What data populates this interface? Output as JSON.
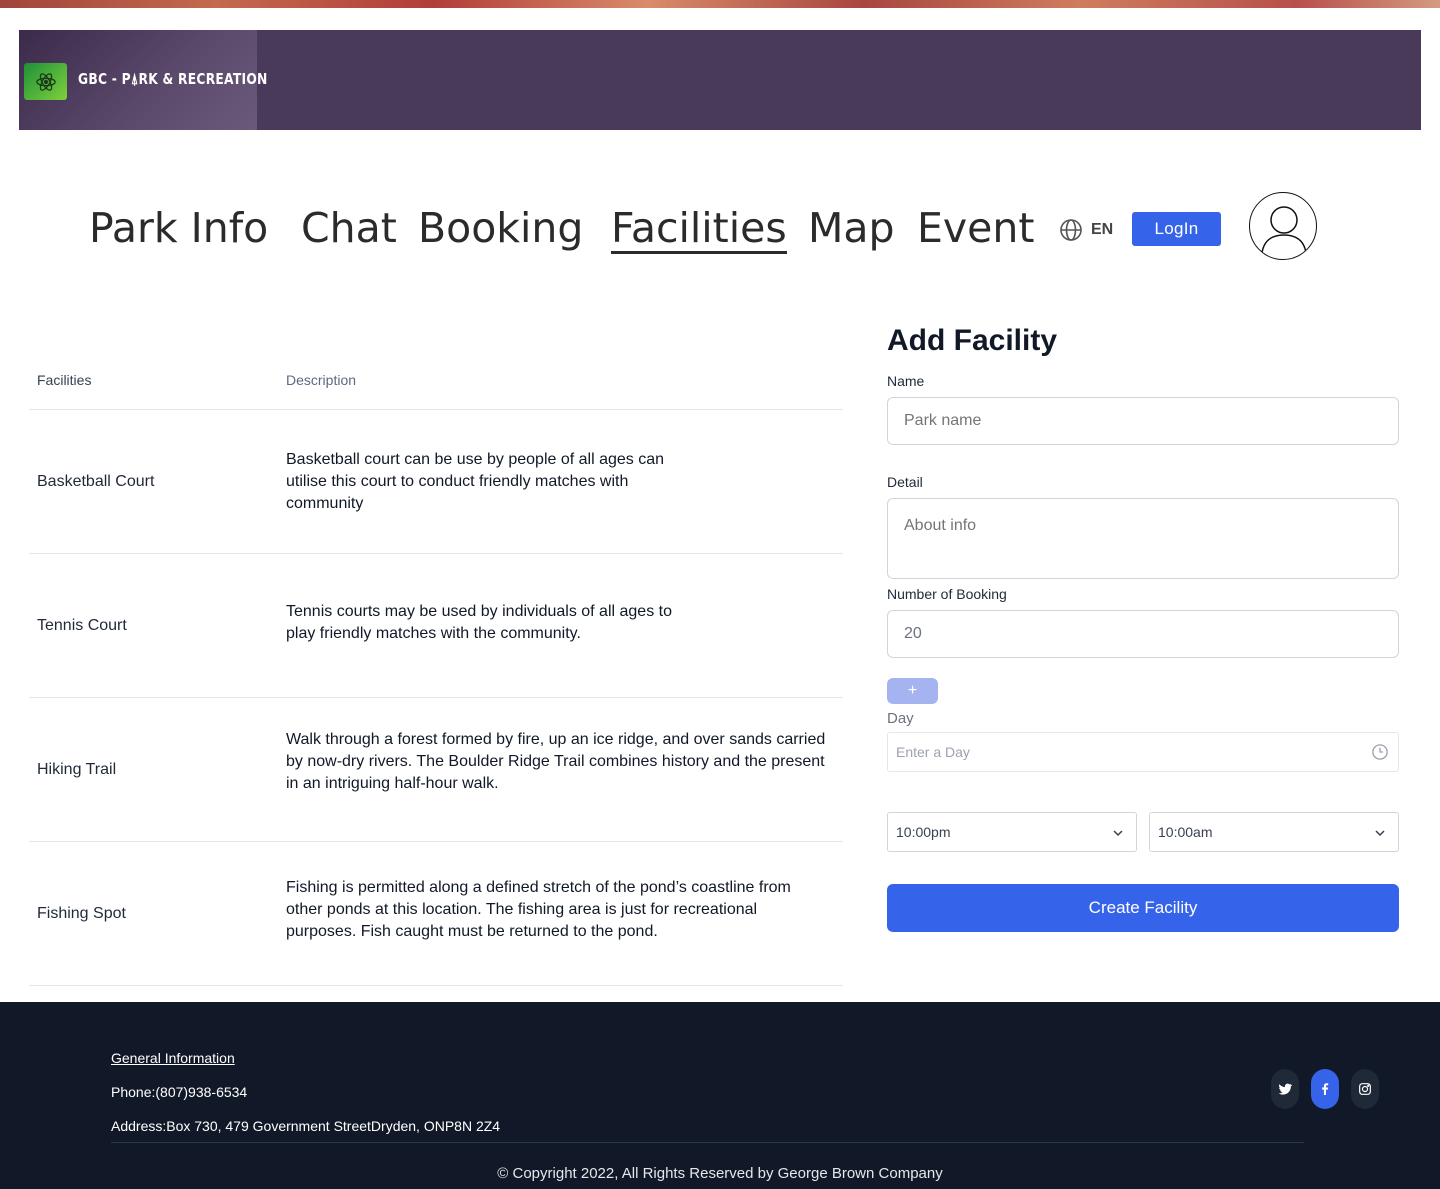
{
  "brand": {
    "name": "GBC - P⍋RK & RECREATION"
  },
  "nav": {
    "items": [
      {
        "label": "Park Info"
      },
      {
        "label": "Chat"
      },
      {
        "label": "Booking"
      },
      {
        "label": "Facilities"
      },
      {
        "label": "Map"
      },
      {
        "label": "Event"
      }
    ],
    "active": "Facilities",
    "language": "EN",
    "login_label": "LogIn"
  },
  "table": {
    "headers": {
      "facilities": "Facilities",
      "description": "Description"
    },
    "rows": [
      {
        "name": "Basketball Court",
        "description": "Basketball court can be use by people of all ages can utilise this court to conduct friendly matches with community"
      },
      {
        "name": "Tennis Court",
        "description": "Tennis courts may be used by individuals of all ages to play friendly matches with the community."
      },
      {
        "name": "Hiking Trail",
        "description": "Walk through a forest formed by fire, up an ice ridge, and over sands carried by now-dry rivers. The Boulder Ridge Trail combines history and the present in an intriguing half-hour walk."
      },
      {
        "name": "Fishing Spot",
        "description": "Fishing is permitted along a defined stretch of the pond’s coastline from other ponds at this location. The fishing area is just for recreational purposes. Fish caught must be returned to the pond."
      }
    ]
  },
  "form": {
    "title": "Add Facility",
    "name_label": "Name",
    "name_placeholder": "Park name",
    "detail_label": "Detail",
    "detail_placeholder": "About info",
    "booking_label": "Number of Booking",
    "booking_value": "20",
    "add_label": "+",
    "day_label": "Day",
    "day_placeholder": "Enter a Day",
    "time_start": "10:00pm",
    "time_end": "10:00am",
    "submit_label": "Create Facility"
  },
  "footer": {
    "general_info": "General Information",
    "phone": "Phone:(807)938-6534",
    "address": "Address:Box 730, 479 Government StreetDryden, ONP8N 2Z4",
    "copyright": "© Copyright 2022, All Rights Reserved by George Brown Company",
    "social": [
      "twitter-icon",
      "facebook-icon",
      "instagram-icon"
    ]
  },
  "colors": {
    "primary": "#3563e9",
    "banner": "#4a3a5a",
    "footer_bg": "#111827"
  }
}
